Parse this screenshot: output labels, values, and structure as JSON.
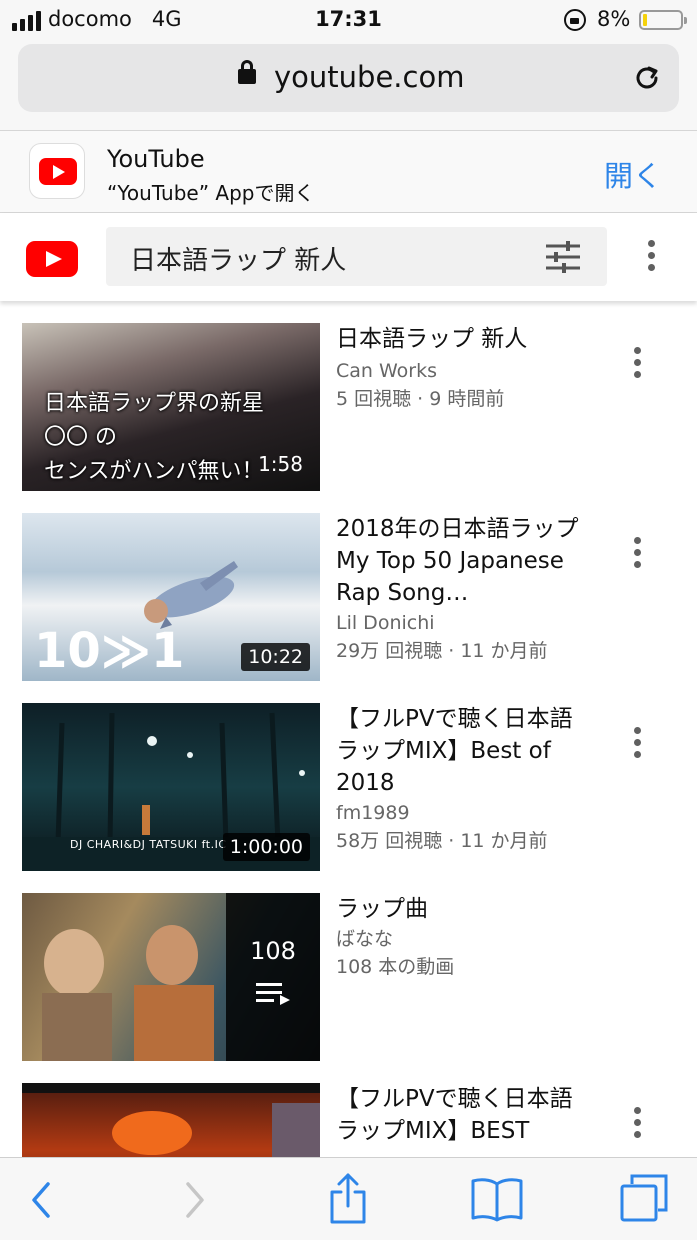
{
  "status_bar": {
    "carrier": "docomo",
    "network": "4G",
    "time": "17:31",
    "battery_percent": "8%",
    "battery_level": 0.08
  },
  "address_bar": {
    "url": "youtube.com",
    "icons": [
      "lock-icon",
      "reload-icon"
    ]
  },
  "app_banner": {
    "title": "YouTube",
    "subtitle": "“YouTube” Appで開く",
    "open_label": "開く",
    "accent_color": "#2e85e8"
  },
  "yt_header": {
    "search_query": "日本語ラップ 新人",
    "brand_color": "#ff0000"
  },
  "results": [
    {
      "thumb_text": [
        "日本語ラップ界の新星",
        "〇〇 の",
        "センスがハンパ無い！"
      ],
      "duration": "1:58",
      "title": "日本語ラップ 新人",
      "channel": "Can Works",
      "stats": "5 回視聴 · 9 時間前"
    },
    {
      "thumb_text": "10≫1",
      "duration": "10:22",
      "title": "2018年の日本語ラップ My Top 50 Japanese Rap Song…",
      "channel": "Lil Donichi",
      "stats": "29万 回視聴 · 11 か月前"
    },
    {
      "thumb_text": "DJ CHARI&DJ TATSUKI ft.IC",
      "duration": "1:00:00",
      "title": "【フルPVで聴く日本語ラップMIX】Best of 2018",
      "channel": "fm1989",
      "stats": "58万 回視聴 · 11 か月前"
    },
    {
      "playlist_count": "108",
      "title": "ラップ曲",
      "channel": "ばなな",
      "stats": "108 本の動画"
    },
    {
      "title": "【フルPVで聴く日本語ラップMIX】BEST"
    }
  ],
  "toolbar": {
    "icons": [
      "back-icon",
      "forward-icon",
      "share-icon",
      "bookmarks-icon",
      "tabs-icon"
    ]
  }
}
